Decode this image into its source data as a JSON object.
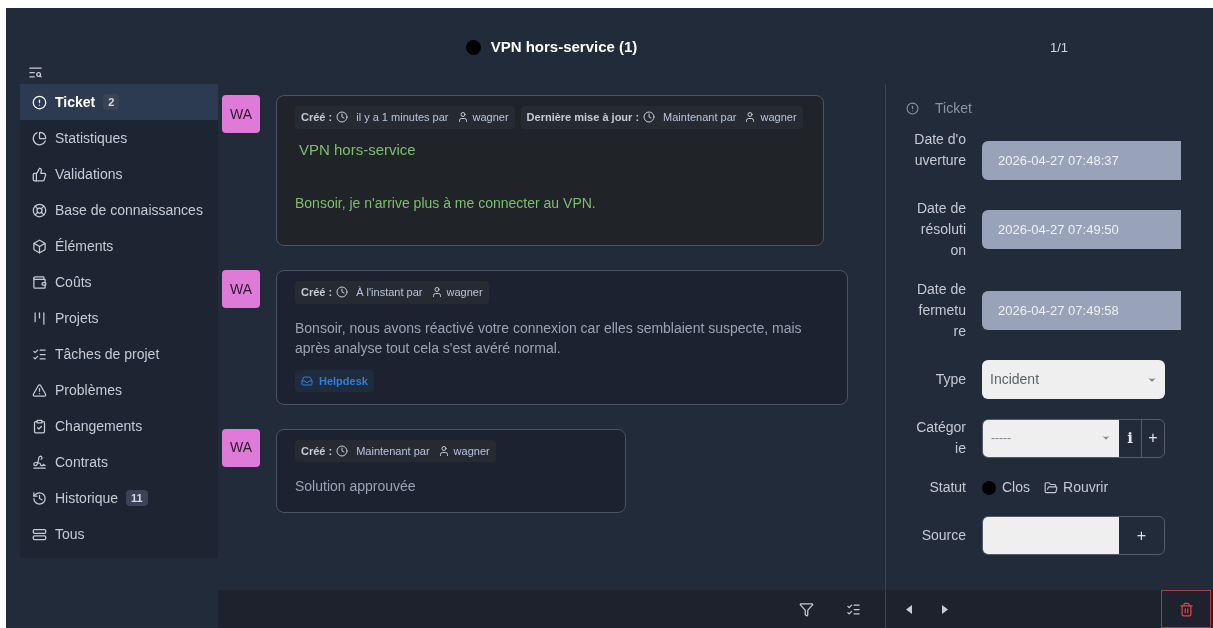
{
  "header": {
    "title": "VPN hors-service (1)",
    "pager": "1/1"
  },
  "sidebar": {
    "items": [
      {
        "label": "Ticket",
        "badge": "2",
        "selected": true
      },
      {
        "label": "Statistiques",
        "selected": false
      },
      {
        "label": "Validations",
        "selected": false
      },
      {
        "label": "Base de connaissances",
        "selected": false
      },
      {
        "label": "Éléments",
        "selected": false
      },
      {
        "label": "Coûts",
        "selected": false
      },
      {
        "label": "Projets",
        "selected": false
      },
      {
        "label": "Tâches de projet",
        "selected": false
      },
      {
        "label": "Problèmes",
        "selected": false
      },
      {
        "label": "Changements",
        "selected": false
      },
      {
        "label": "Contrats",
        "selected": false
      },
      {
        "label": "Historique",
        "badge": "11",
        "selected": false
      },
      {
        "label": "Tous",
        "selected": false
      }
    ]
  },
  "timeline": [
    {
      "kind": "ticket",
      "avatar": "WA",
      "meta": [
        {
          "label": "Créé :",
          "time": "il y a 1 minutes par",
          "author": "wagner"
        },
        {
          "label": "Dernière mise à jour :",
          "time": "Maintenant par",
          "author": "wagner"
        }
      ],
      "title": "VPN hors-service",
      "content": "Bonsoir, je n'arrive plus à me connecter au VPN."
    },
    {
      "kind": "followup",
      "avatar": "WA",
      "meta": [
        {
          "label": "Créé :",
          "time": "À l'instant par",
          "author": "wagner"
        }
      ],
      "content": "Bonsoir, nous avons réactivé votre connexion car elles semblaient suspecte, mais après analyse tout cela s'est avéré normal.",
      "source": "Helpdesk"
    },
    {
      "kind": "solution",
      "avatar": "WA",
      "meta": [
        {
          "label": "Créé :",
          "time": "Maintenant par",
          "author": "wagner"
        }
      ],
      "content": "Solution approuvée"
    }
  ],
  "panel": {
    "title": "Ticket",
    "fields": [
      {
        "kind": "date",
        "label": "Date d'ouverture",
        "value": "2026-04-27 07:48:37"
      },
      {
        "kind": "date",
        "label": "Date de résolution",
        "value": "2026-04-27 07:49:50"
      },
      {
        "kind": "date",
        "label": "Date de fermeture",
        "value": "2026-04-27 07:49:58"
      },
      {
        "kind": "select",
        "label": "Type",
        "value": "Incident"
      },
      {
        "kind": "select_actions",
        "label": "Catégorie",
        "value": "-----",
        "info": "i",
        "add": "+"
      },
      {
        "kind": "status",
        "label": "Statut",
        "value": "Clos",
        "action": "Rouvrir"
      },
      {
        "kind": "select_actions",
        "label": "Source",
        "add": "+"
      }
    ]
  }
}
